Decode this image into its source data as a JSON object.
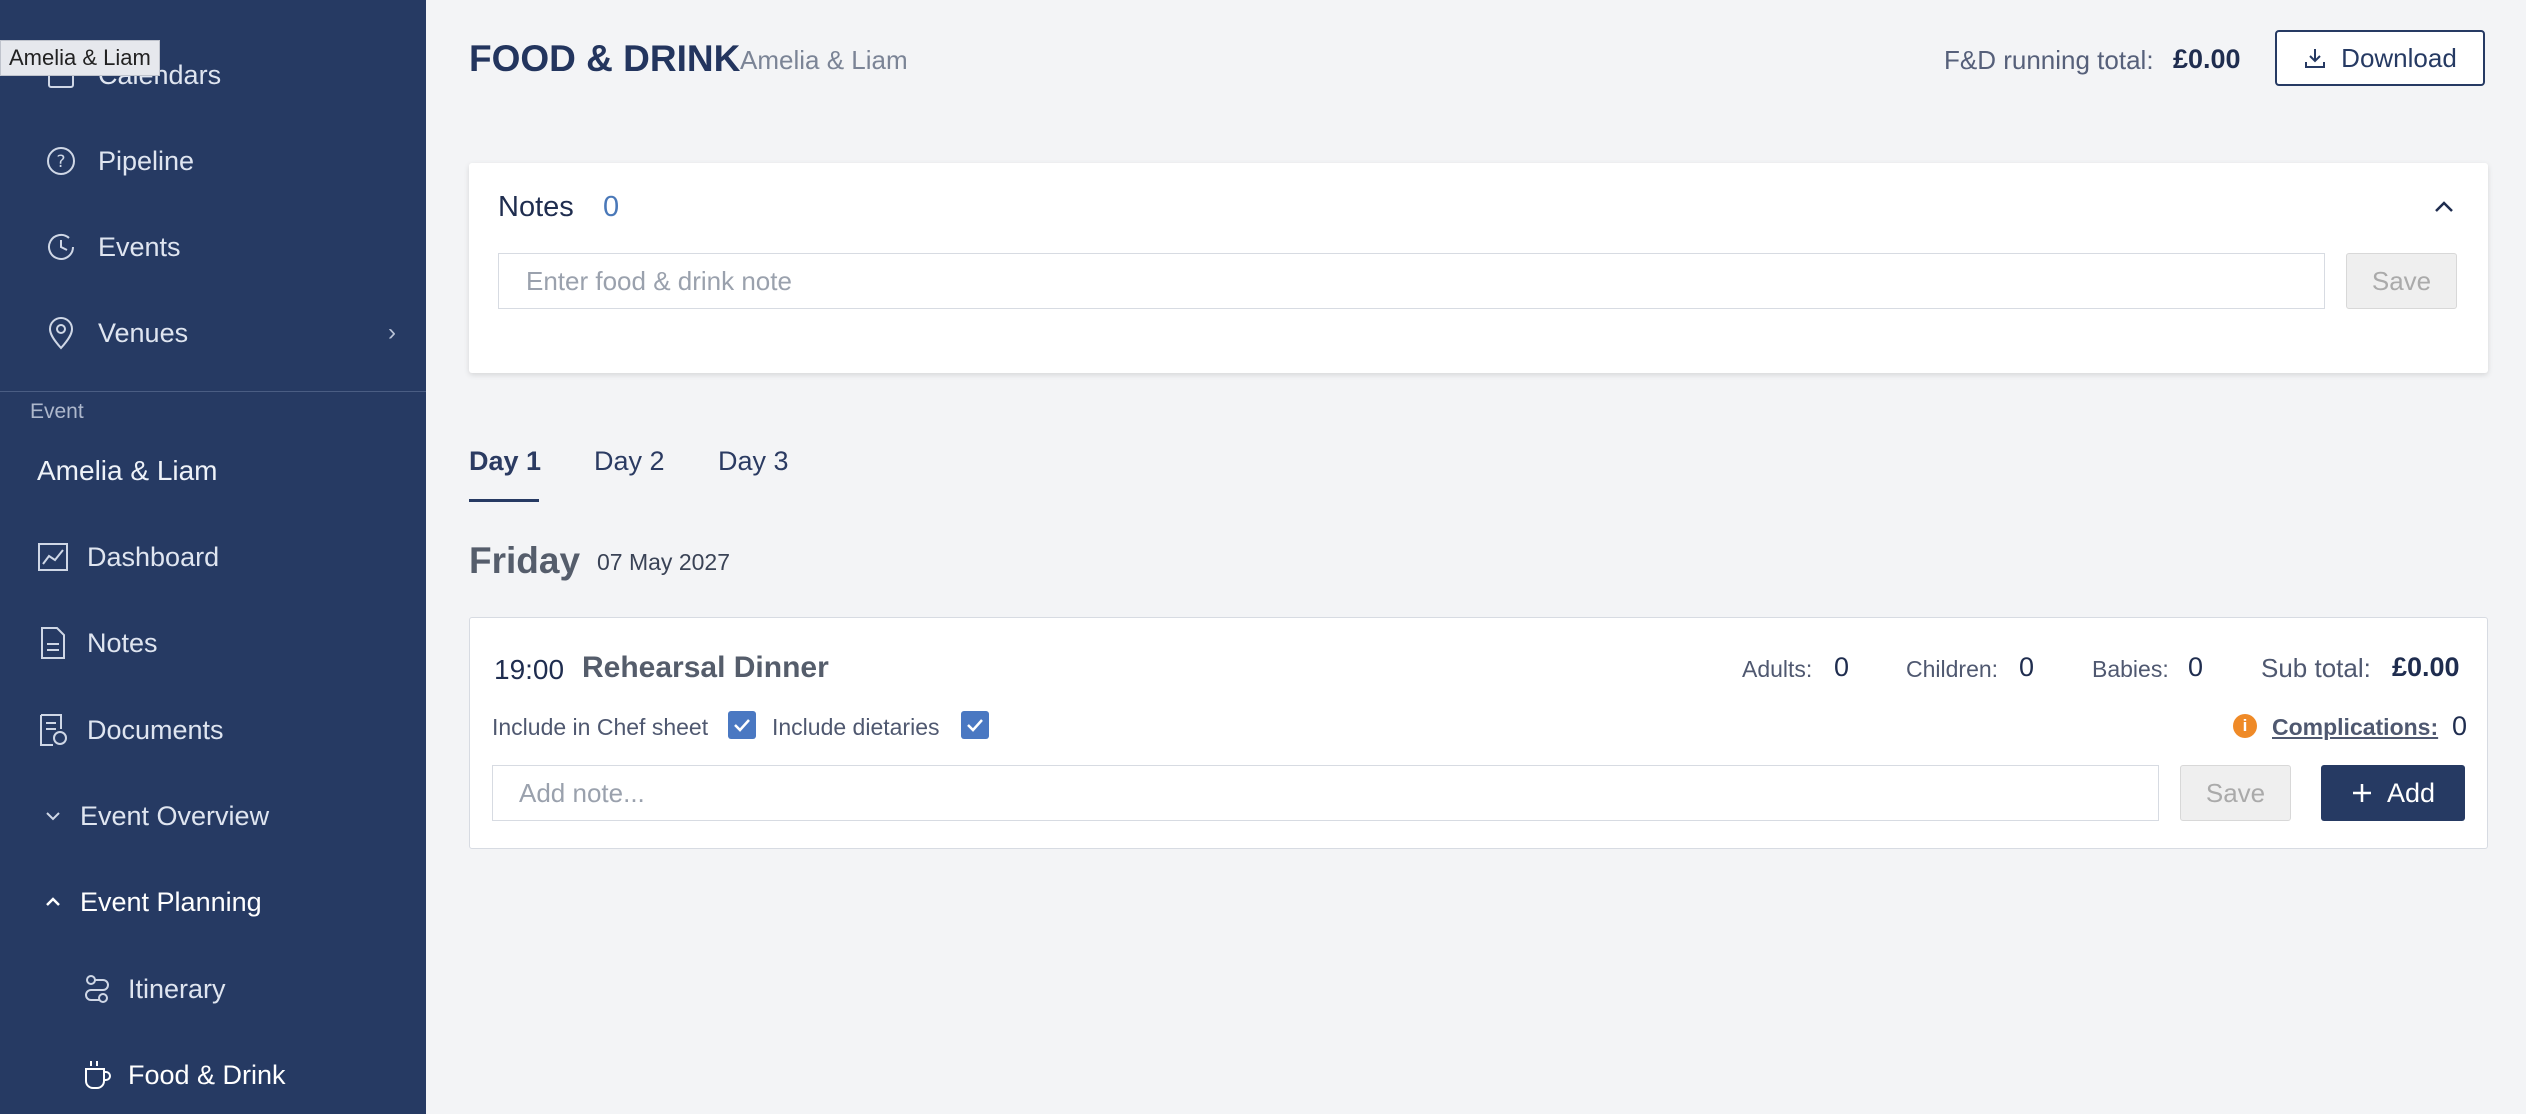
{
  "tooltip": "Amelia & Liam",
  "sidebar": {
    "items": [
      {
        "label": "Calendars",
        "icon": "calendar-icon"
      },
      {
        "label": "Pipeline",
        "icon": "question-circle-icon"
      },
      {
        "label": "Events",
        "icon": "clock-history-icon"
      },
      {
        "label": "Venues",
        "icon": "map-pin-icon"
      }
    ],
    "section_label": "Event",
    "event_name": "Amelia & Liam",
    "event_items": [
      {
        "label": "Dashboard",
        "icon": "chart-line-icon"
      },
      {
        "label": "Notes",
        "icon": "document-icon"
      },
      {
        "label": "Documents",
        "icon": "document-check-icon"
      }
    ],
    "groups": [
      {
        "label": "Event Overview",
        "state": "collapsed"
      },
      {
        "label": "Event Planning",
        "state": "expanded"
      }
    ],
    "children": [
      {
        "label": "Itinerary",
        "icon": "route-icon"
      },
      {
        "label": "Food & Drink",
        "icon": "coffee-cup-icon"
      }
    ]
  },
  "header": {
    "title": "FOOD & DRINK",
    "subtitle": "Amelia & Liam",
    "running_total_label": "F&D running total:",
    "running_total_value": "£0.00",
    "download_label": "Download"
  },
  "notes": {
    "title": "Notes",
    "count": "0",
    "placeholder": "Enter food & drink note",
    "save_label": "Save"
  },
  "tabs": [
    {
      "label": "Day 1",
      "active": true
    },
    {
      "label": "Day 2",
      "active": false
    },
    {
      "label": "Day 3",
      "active": false
    }
  ],
  "day": {
    "name": "Friday",
    "date": "07 May 2027"
  },
  "event": {
    "time": "19:00",
    "name": "Rehearsal Dinner",
    "adults_label": "Adults:",
    "adults_value": "0",
    "children_label": "Children:",
    "children_value": "0",
    "babies_label": "Babies:",
    "babies_value": "0",
    "subtotal_label": "Sub total:",
    "subtotal_value": "£0.00",
    "chef_sheet_label": "Include in Chef sheet",
    "chef_sheet_checked": true,
    "dietaries_label": "Include dietaries",
    "dietaries_checked": true,
    "complications_label": "Complications:",
    "complications_value": "0",
    "note_placeholder": "Add note...",
    "save_label": "Save",
    "add_label": "Add"
  },
  "colors": {
    "sidebar_bg": "#263a63",
    "accent": "#4a78c2",
    "warning": "#ef8a27"
  }
}
